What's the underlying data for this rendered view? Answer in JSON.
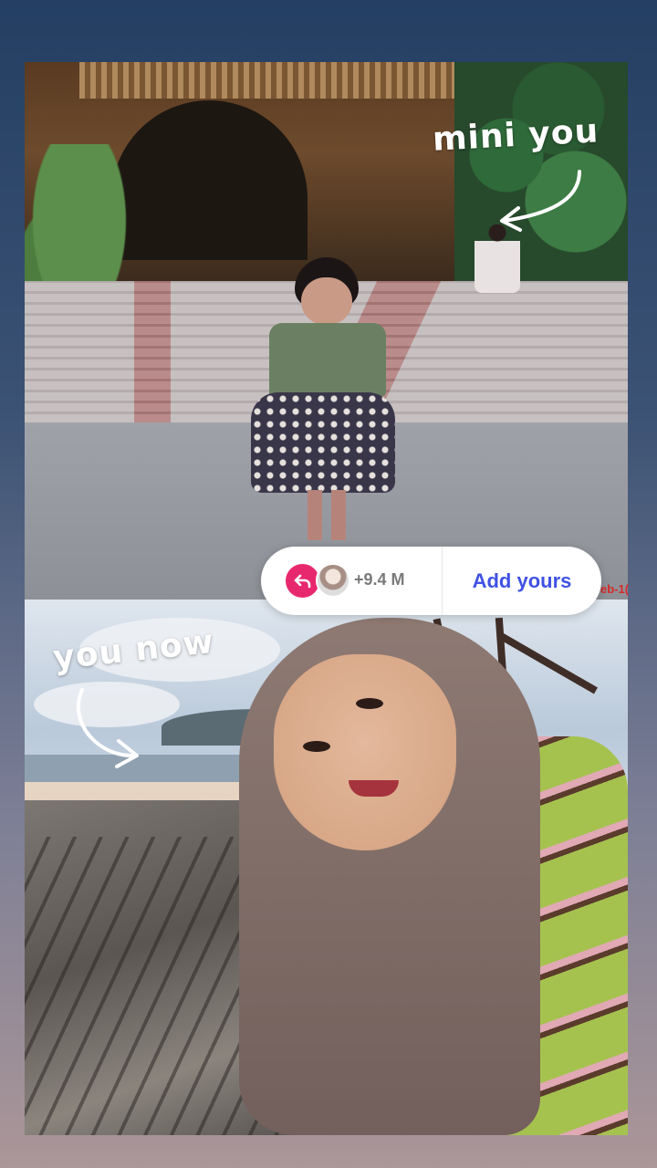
{
  "stickers": {
    "top_label": "mini you",
    "bottom_label": "you now"
  },
  "add_yours": {
    "count": "+9.4 M",
    "action_label": "Add yours",
    "accent_color": "#e8286e",
    "action_color": "#3f52e3"
  },
  "photo_stamp": "eb-1("
}
